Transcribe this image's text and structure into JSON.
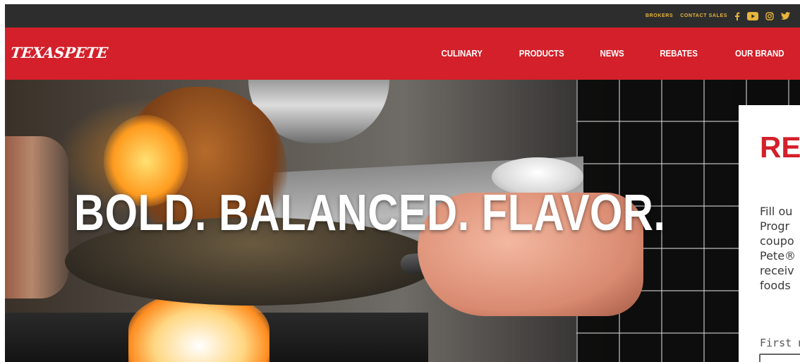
{
  "utility_bar": {
    "links": [
      "BROKERS",
      "CONTACT SALES"
    ],
    "social_icons": [
      "facebook-icon",
      "youtube-icon",
      "instagram-icon",
      "twitter-icon"
    ]
  },
  "brand": {
    "logo_text": "TEXASPETE",
    "primary_color": "#d3202a",
    "accent_color": "#e8b53c"
  },
  "nav": {
    "items": [
      "CULINARY",
      "PRODUCTS",
      "NEWS",
      "REBATES",
      "OUR BRAND"
    ]
  },
  "hero": {
    "headline": "BOLD. BALANCED. FLAVOR."
  },
  "form_panel": {
    "heading": "RE",
    "text_lines": [
      "Fill ou",
      "Progr",
      "coupo",
      "Pete®",
      "receiv",
      "foods"
    ],
    "first_name_label": "First n"
  }
}
